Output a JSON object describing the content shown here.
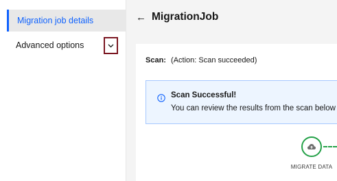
{
  "sidebar": {
    "items": [
      {
        "label": "Migration job details"
      },
      {
        "label": "Advanced options",
        "toggle_icon": "chevron-down-icon"
      }
    ]
  },
  "header": {
    "back_icon": "arrow-left-icon",
    "back_glyph": "←",
    "title": "MigrationJob"
  },
  "scan": {
    "label": "Scan:",
    "status": "(Action: Scan succeeded)"
  },
  "notification": {
    "icon": "info-icon",
    "title": "Scan Successful!",
    "body": "You can review the results from the scan below a"
  },
  "progress_step": {
    "icon": "cloud-upload-icon",
    "label": "MIGRATE DATA",
    "color": "#24a148"
  },
  "colors": {
    "accent": "#0f62fe",
    "highlight_border": "#7a1520",
    "success": "#24a148",
    "info_bg": "#edf5ff"
  }
}
